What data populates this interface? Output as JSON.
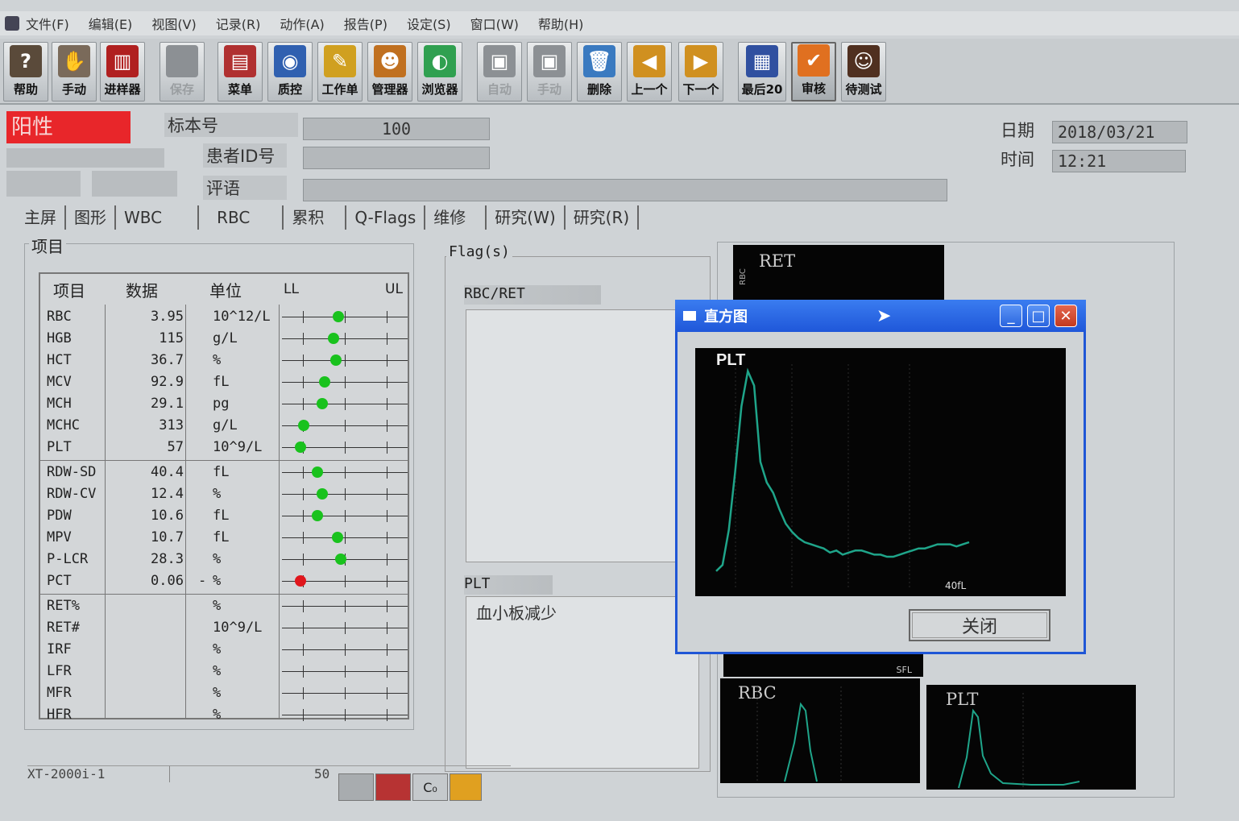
{
  "menu": [
    "文件(F)",
    "编辑(E)",
    "视图(V)",
    "记录(R)",
    "动作(A)",
    "报告(P)",
    "设定(S)",
    "窗口(W)",
    "帮助(H)"
  ],
  "toolbar": [
    {
      "label": "帮助",
      "icon": "help-icon",
      "enabled": true
    },
    {
      "label": "手动",
      "icon": "manual-icon",
      "enabled": true
    },
    {
      "label": "进样器",
      "icon": "sampler-icon",
      "enabled": true
    },
    {
      "label": "保存",
      "icon": "save-icon",
      "enabled": false
    },
    {
      "label": "菜单",
      "icon": "menu-icon",
      "enabled": true
    },
    {
      "label": "质控",
      "icon": "qc-icon",
      "enabled": true
    },
    {
      "label": "工作单",
      "icon": "worklist-icon",
      "enabled": true
    },
    {
      "label": "管理器",
      "icon": "manager-icon",
      "enabled": true
    },
    {
      "label": "浏览器",
      "icon": "browser-icon",
      "enabled": true
    },
    {
      "label": "自动",
      "icon": "auto-icon",
      "enabled": false
    },
    {
      "label": "手动",
      "icon": "manual2-icon",
      "enabled": false
    },
    {
      "label": "删除",
      "icon": "delete-icon",
      "enabled": true
    },
    {
      "label": "上一个",
      "icon": "prev-icon",
      "enabled": true
    },
    {
      "label": "下一个",
      "icon": "next-icon",
      "enabled": true
    },
    {
      "label": "最后20",
      "icon": "last20-icon",
      "enabled": true
    },
    {
      "label": "审核",
      "icon": "validate-icon",
      "enabled": true
    },
    {
      "label": "待测试",
      "icon": "pending-icon",
      "enabled": true
    }
  ],
  "status": {
    "text": "阳性",
    "color": "#e8262a"
  },
  "sample": {
    "id_label": "标本号",
    "id_value": "100",
    "patient_label": "患者ID号",
    "patient_value": "",
    "comment_label": "评语",
    "comment_value": "",
    "date_label": "日期",
    "date_value": "2018/03/21",
    "time_label": "时间",
    "time_value": "12:21"
  },
  "tabs": [
    "主屏",
    "图形",
    "WBC",
    "RBC",
    "累积",
    "Q-Flags",
    "维修",
    "研究(W)",
    "研究(R)"
  ],
  "active_tab": "RBC",
  "items_panel": {
    "title": "项目",
    "headers": {
      "name": "项目",
      "value": "数据",
      "unit": "单位",
      "ll": "LL",
      "ul": "UL"
    },
    "rows": [
      {
        "name": "RBC",
        "value": "3.95",
        "flag": "",
        "unit": "10^12/L",
        "level": 0.45,
        "status": "normal"
      },
      {
        "name": "HGB",
        "value": "115",
        "flag": "",
        "unit": "g/L",
        "level": 0.41,
        "status": "normal"
      },
      {
        "name": "HCT",
        "value": "36.7",
        "flag": "",
        "unit": "%",
        "level": 0.43,
        "status": "normal"
      },
      {
        "name": "MCV",
        "value": "92.9",
        "flag": "",
        "unit": "fL",
        "level": 0.34,
        "status": "normal"
      },
      {
        "name": "MCH",
        "value": "29.1",
        "flag": "",
        "unit": "pg",
        "level": 0.32,
        "status": "normal"
      },
      {
        "name": "MCHC",
        "value": "313",
        "flag": "",
        "unit": "g/L",
        "level": 0.17,
        "status": "normal"
      },
      {
        "name": "PLT",
        "value": "57",
        "flag": "",
        "unit": "10^9/L",
        "level": 0.15,
        "status": "normal"
      },
      {
        "name": "RDW-SD",
        "value": "40.4",
        "flag": "",
        "unit": "fL",
        "level": 0.28,
        "status": "normal"
      },
      {
        "name": "RDW-CV",
        "value": "12.4",
        "flag": "",
        "unit": "%",
        "level": 0.32,
        "status": "normal"
      },
      {
        "name": "PDW",
        "value": "10.6",
        "flag": "",
        "unit": "fL",
        "level": 0.28,
        "status": "normal"
      },
      {
        "name": "MPV",
        "value": "10.7",
        "flag": "",
        "unit": "fL",
        "level": 0.44,
        "status": "normal"
      },
      {
        "name": "P-LCR",
        "value": "28.3",
        "flag": "",
        "unit": "%",
        "level": 0.47,
        "status": "normal"
      },
      {
        "name": "PCT",
        "value": "0.06",
        "flag": "-",
        "unit": "%",
        "level": 0.15,
        "status": "low"
      },
      {
        "name": "RET%",
        "value": "",
        "flag": "",
        "unit": "%",
        "level": null,
        "status": ""
      },
      {
        "name": "RET#",
        "value": "",
        "flag": "",
        "unit": "10^9/L",
        "level": null,
        "status": ""
      },
      {
        "name": "IRF",
        "value": "",
        "flag": "",
        "unit": "%",
        "level": null,
        "status": ""
      },
      {
        "name": "LFR",
        "value": "",
        "flag": "",
        "unit": "%",
        "level": null,
        "status": ""
      },
      {
        "name": "MFR",
        "value": "",
        "flag": "",
        "unit": "%",
        "level": null,
        "status": ""
      },
      {
        "name": "HFR",
        "value": "",
        "flag": "",
        "unit": "%",
        "level": null,
        "status": ""
      }
    ]
  },
  "flags_panel": {
    "title": "Flag(s)",
    "rbc_ret_label": "RBC/RET",
    "plt_label": "PLT",
    "plt_message": "血小板减少"
  },
  "scattergrams": {
    "ret_title": "RET",
    "ret_axis": "RBC",
    "sfl_label": "SFL",
    "rbc_title": "RBC",
    "plt_title": "PLT"
  },
  "dialog": {
    "title": "直方图",
    "close_label": "关闭",
    "hist_title": "PLT",
    "hist_marker": "40fL"
  },
  "chart_data": {
    "type": "line",
    "title": "PLT",
    "x_marker": "40fL",
    "x": [
      0,
      1,
      2,
      3,
      4,
      5,
      6,
      7,
      8,
      9,
      10,
      11,
      12,
      13,
      14,
      15,
      16,
      17,
      18,
      19,
      20,
      21,
      22,
      23,
      24,
      25,
      26,
      27,
      28,
      29,
      30,
      31,
      32,
      33,
      34,
      35,
      36,
      37,
      38,
      39,
      40
    ],
    "y": [
      2,
      5,
      22,
      50,
      82,
      99,
      92,
      55,
      45,
      40,
      32,
      25,
      21,
      18,
      16,
      15,
      14,
      13,
      11,
      12,
      10,
      11,
      12,
      12,
      11,
      10,
      10,
      9,
      9,
      10,
      11,
      12,
      13,
      13,
      14,
      15,
      15,
      15,
      14,
      15,
      16
    ],
    "line_color": "#1fa58a",
    "background": "#050505"
  },
  "bottom_status": {
    "left": "XT-2000i-1",
    "number": "50"
  }
}
